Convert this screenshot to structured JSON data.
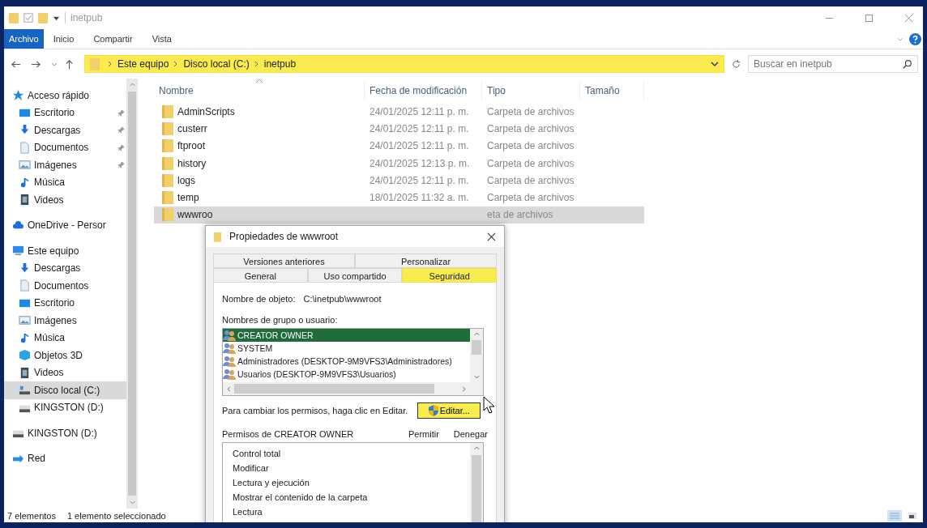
{
  "window": {
    "title": "inetpub"
  },
  "ribbon_tabs": [
    {
      "label": "Archivo",
      "kind": "file"
    },
    {
      "label": "Inicio",
      "kind": "tab"
    },
    {
      "label": "Compartir",
      "kind": "tab"
    },
    {
      "label": "Vista",
      "kind": "tab"
    }
  ],
  "address_bar": {
    "crumbs": [
      "Este equipo",
      "Disco local (C:)",
      "inetpub"
    ],
    "highlighted": true
  },
  "search": {
    "placeholder": "Buscar en inetpub"
  },
  "sidebar": {
    "items": [
      {
        "label": "Acceso rápido",
        "kind": "star",
        "selected": false,
        "children": [
          {
            "label": "Escritorio",
            "kind": "desktop",
            "pinned": true,
            "selected": false
          },
          {
            "label": "Descargas",
            "kind": "download",
            "pinned": true,
            "selected": false
          },
          {
            "label": "Documentos",
            "kind": "document",
            "pinned": true,
            "selected": false
          },
          {
            "label": "Imágenes",
            "kind": "pictures",
            "pinned": true,
            "selected": false
          },
          {
            "label": "Música",
            "kind": "music",
            "pinned": false,
            "selected": false
          },
          {
            "label": "Videos",
            "kind": "video",
            "pinned": false,
            "selected": false
          }
        ]
      },
      {
        "label": "OneDrive - Persor",
        "kind": "cloud",
        "selected": false
      },
      {
        "label": "Este equipo",
        "kind": "computer",
        "selected": false,
        "children": [
          {
            "label": "Descargas",
            "kind": "download",
            "pinned": false,
            "selected": false
          },
          {
            "label": "Documentos",
            "kind": "document",
            "pinned": false,
            "selected": false
          },
          {
            "label": "Escritorio",
            "kind": "desktop",
            "pinned": false,
            "selected": false
          },
          {
            "label": "Imágenes",
            "kind": "pictures",
            "pinned": false,
            "selected": false
          },
          {
            "label": "Música",
            "kind": "music",
            "pinned": false,
            "selected": false
          },
          {
            "label": "Objetos 3D",
            "kind": "cube",
            "pinned": false,
            "selected": false
          },
          {
            "label": "Videos",
            "kind": "video",
            "pinned": false,
            "selected": false
          },
          {
            "label": "Disco local (C:)",
            "kind": "drive",
            "pinned": false,
            "selected": true
          },
          {
            "label": "KINGSTON (D:)",
            "kind": "usb",
            "pinned": false,
            "selected": false
          }
        ]
      },
      {
        "label": "KINGSTON (D:)",
        "kind": "usb",
        "selected": false
      },
      {
        "label": "Red",
        "kind": "network",
        "selected": false
      }
    ]
  },
  "table": {
    "columns": [
      "Nombre",
      "Fecha de modificación",
      "Tipo",
      "Tamaño"
    ],
    "rows": [
      {
        "name": "AdminScripts",
        "date": "24/01/2025 12:11 p. m.",
        "type": "Carpeta de archivos",
        "selected": false
      },
      {
        "name": "custerr",
        "date": "24/01/2025 12:11 p. m.",
        "type": "Carpeta de archivos",
        "selected": false
      },
      {
        "name": "ftproot",
        "date": "24/01/2025 12:11 p. m.",
        "type": "Carpeta de archivos",
        "selected": false
      },
      {
        "name": "history",
        "date": "24/01/2025 12:13 p. m.",
        "type": "Carpeta de archivos",
        "selected": false
      },
      {
        "name": "logs",
        "date": "24/01/2025 12:11 p. m.",
        "type": "Carpeta de archivos",
        "selected": false
      },
      {
        "name": "temp",
        "date": "18/01/2025 11:32 a. m.",
        "type": "Carpeta de archivos",
        "selected": false
      },
      {
        "name": "wwwroo",
        "date": "",
        "type": "eta de archivos",
        "selected": true
      }
    ]
  },
  "status_bar": {
    "count": "7 elementos",
    "selection": "1 elemento seleccionado"
  },
  "dialog": {
    "title": "Propiedades de wwwroot",
    "tab_rows": [
      [
        {
          "label": "Versiones anteriores",
          "selected": false
        },
        {
          "label": "Personalizar",
          "selected": false
        }
      ],
      [
        {
          "label": "General",
          "selected": false
        },
        {
          "label": "Uso compartido",
          "selected": false
        },
        {
          "label": "Seguridad",
          "selected": true
        }
      ]
    ],
    "object_label": "Nombre de objeto:",
    "object_value": "C:\\inetpub\\wwwroot",
    "users_label": "Nombres de grupo o usuario:",
    "users": [
      {
        "name": "CREATOR OWNER",
        "selected": true
      },
      {
        "name": "SYSTEM",
        "selected": false
      },
      {
        "name": "Administradores (DESKTOP-9M9VFS3\\Administradores)",
        "selected": false
      },
      {
        "name": "Usuarios (DESKTOP-9M9VFS3\\Usuarios)",
        "selected": false
      }
    ],
    "edit_hint": "Para cambiar los permisos, haga clic en Editar.",
    "edit_button": {
      "label": "Editar...",
      "highlighted": true
    },
    "permissions_label": "Permisos de CREATOR OWNER",
    "allow_label": "Permitir",
    "deny_label": "Denegar",
    "permissions": [
      "Control total",
      "Modificar",
      "Lectura y ejecución",
      "Mostrar el contenido de la carpeta",
      "Lectura"
    ]
  }
}
